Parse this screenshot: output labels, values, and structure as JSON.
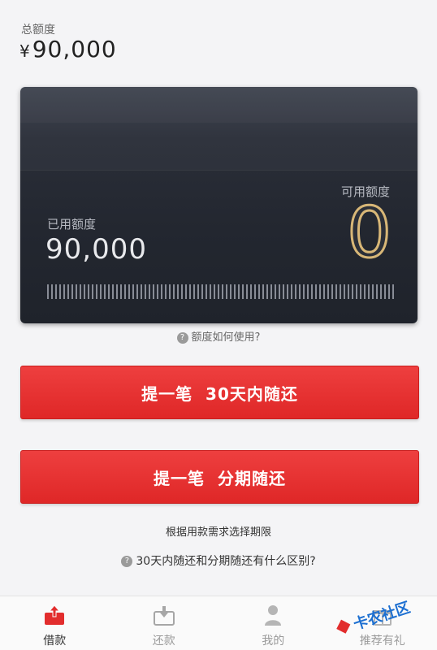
{
  "header": {
    "total_label": "总额度",
    "currency": "¥",
    "total_value": "90,000"
  },
  "card": {
    "used_label": "已用额度",
    "used_value": "90,000",
    "available_label": "可用额度",
    "available_value": "0"
  },
  "help": {
    "usage_link": "额度如何使用?"
  },
  "buttons": {
    "btn_30days": "提一笔  30天内随还",
    "btn_installment": "提一笔  分期随还"
  },
  "hint": "根据用款需求选择期限",
  "faq": {
    "difference_link": "30天内随还和分期随还有什么区别?"
  },
  "tabbar": {
    "items": [
      {
        "label": "借款",
        "icon": "borrow-icon",
        "active": true
      },
      {
        "label": "还款",
        "icon": "repay-icon",
        "active": false
      },
      {
        "label": "我的",
        "icon": "profile-icon",
        "active": false
      },
      {
        "label": "推荐有礼",
        "icon": "gift-icon",
        "active": false
      }
    ]
  },
  "watermark": {
    "text": "卡农社区"
  },
  "colors": {
    "primary_red": "#e22d2d",
    "card_dark": "#232730",
    "gold": "#d8b777"
  }
}
